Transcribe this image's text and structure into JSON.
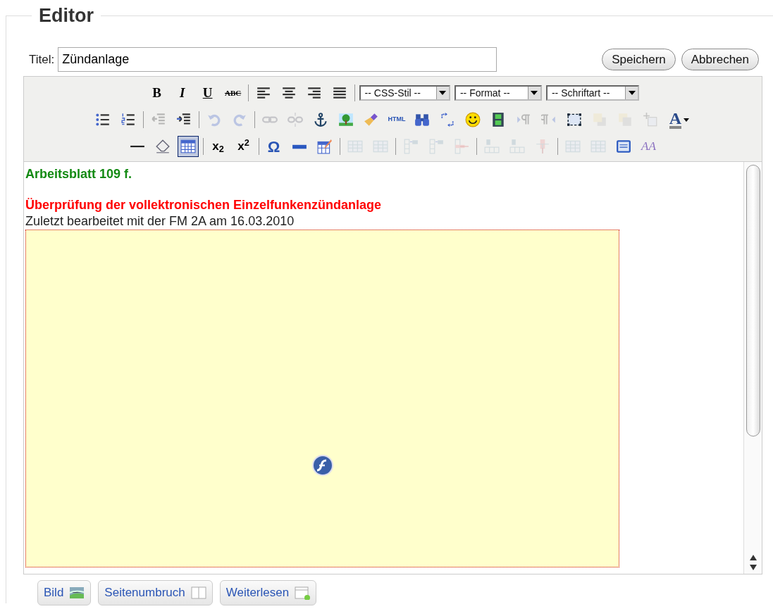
{
  "legend": "Editor",
  "title_field": {
    "label": "Titel:",
    "value": "Zündanlage"
  },
  "actions": [
    "Speichern",
    "Abbrechen"
  ],
  "toolbar": [
    [
      {
        "kind": "bold",
        "label": "B",
        "disabled": false,
        "selected": false
      },
      {
        "kind": "italic",
        "label": "I",
        "disabled": false,
        "selected": false
      },
      {
        "kind": "underline",
        "label": "U",
        "disabled": false,
        "selected": false
      },
      {
        "kind": "strike",
        "label": "ABC",
        "disabled": false,
        "selected": false
      },
      {
        "kind": "separator"
      },
      {
        "kind": "alignleft",
        "disabled": false,
        "selected": false
      },
      {
        "kind": "aligncenter",
        "disabled": false,
        "selected": false
      },
      {
        "kind": "alignright",
        "disabled": false,
        "selected": false
      },
      {
        "kind": "alignjustify",
        "disabled": false,
        "selected": false
      },
      {
        "kind": "separator"
      },
      {
        "kind": "select",
        "value": "-- CSS-Stil --"
      },
      {
        "kind": "select",
        "value": "-- Format --"
      },
      {
        "kind": "select",
        "value": "-- Schriftart --"
      }
    ],
    [
      {
        "kind": "bullets",
        "disabled": false,
        "selected": false
      },
      {
        "kind": "numbers",
        "disabled": false,
        "selected": false
      },
      {
        "kind": "separator"
      },
      {
        "kind": "outdent",
        "disabled": true,
        "selected": false
      },
      {
        "kind": "indent",
        "disabled": false,
        "selected": false
      },
      {
        "kind": "separator"
      },
      {
        "kind": "undo",
        "disabled": true,
        "selected": false
      },
      {
        "kind": "redo",
        "disabled": true,
        "selected": false
      },
      {
        "kind": "separator"
      },
      {
        "kind": "link",
        "disabled": true,
        "selected": false
      },
      {
        "kind": "unlink",
        "disabled": true,
        "selected": false
      },
      {
        "kind": "anchor",
        "disabled": false,
        "selected": false
      },
      {
        "kind": "image",
        "disabled": false,
        "selected": false
      },
      {
        "kind": "brush",
        "disabled": false,
        "selected": false
      },
      {
        "kind": "html",
        "label": "HTML",
        "disabled": false,
        "selected": false
      },
      {
        "kind": "search",
        "disabled": false,
        "selected": false
      },
      {
        "kind": "replace",
        "disabled": false,
        "selected": false
      },
      {
        "kind": "smiley",
        "disabled": false,
        "selected": false
      },
      {
        "kind": "film",
        "disabled": false,
        "selected": false
      },
      {
        "kind": "ltr",
        "disabled": true,
        "selected": false
      },
      {
        "kind": "rtl",
        "disabled": true,
        "selected": false
      },
      {
        "kind": "visualaid",
        "disabled": false,
        "selected": false
      },
      {
        "kind": "forward",
        "disabled": true,
        "selected": false
      },
      {
        "kind": "backward",
        "disabled": true,
        "selected": false
      },
      {
        "kind": "layer",
        "disabled": true,
        "selected": false
      },
      {
        "kind": "forecolor",
        "label": "A",
        "disabled": false,
        "selected": false
      }
    ],
    [
      {
        "kind": "rule",
        "disabled": false,
        "selected": false
      },
      {
        "kind": "eraser",
        "disabled": false,
        "selected": false
      },
      {
        "kind": "table",
        "disabled": false,
        "selected": true
      },
      {
        "kind": "separator"
      },
      {
        "kind": "script",
        "label": "x$_{2}$",
        "disabled": false,
        "selected": false
      },
      {
        "kind": "script",
        "label": "x$^{2}$",
        "disabled": false,
        "selected": false
      },
      {
        "kind": "separator"
      },
      {
        "kind": "symbol",
        "label": "Ω",
        "disabled": false,
        "selected": false
      },
      {
        "kind": "hrbar",
        "disabled": false,
        "selected": false
      },
      {
        "kind": "tableedit",
        "disabled": false,
        "selected": false
      },
      {
        "kind": "separator"
      },
      {
        "kind": "grid",
        "disabled": true,
        "selected": false
      },
      {
        "kind": "grid",
        "disabled": true,
        "selected": false
      },
      {
        "kind": "separator"
      },
      {
        "kind": "rowinsert",
        "disabled": true,
        "selected": false
      },
      {
        "kind": "rowinsert",
        "disabled": true,
        "selected": false
      },
      {
        "kind": "rowdelete",
        "disabled": true,
        "selected": false
      },
      {
        "kind": "separator"
      },
      {
        "kind": "colinsert",
        "disabled": true,
        "selected": false
      },
      {
        "kind": "colinsert",
        "disabled": true,
        "selected": false
      },
      {
        "kind": "coldelete",
        "disabled": true,
        "selected": false
      },
      {
        "kind": "separator"
      },
      {
        "kind": "grid",
        "disabled": true,
        "selected": false
      },
      {
        "kind": "grid",
        "disabled": true,
        "selected": false
      },
      {
        "kind": "panel",
        "disabled": false,
        "selected": false
      },
      {
        "kind": "styleprops",
        "label": "AA",
        "disabled": true,
        "selected": false
      }
    ]
  ],
  "content": {
    "heading": "Arbeitsblatt 109 f.",
    "subheading": "Überprüfung der vollektronischen Einzelfunkenzündanlage",
    "note": "Zuletzt bearbeitet mit der FM 2A am 16.03.2010"
  },
  "buttons": [
    {
      "label": "Bild",
      "kind": "image"
    },
    {
      "label": "Seitenumbruch",
      "kind": "pagebreak"
    },
    {
      "label": "Weiterlesen",
      "kind": "readmore"
    }
  ]
}
